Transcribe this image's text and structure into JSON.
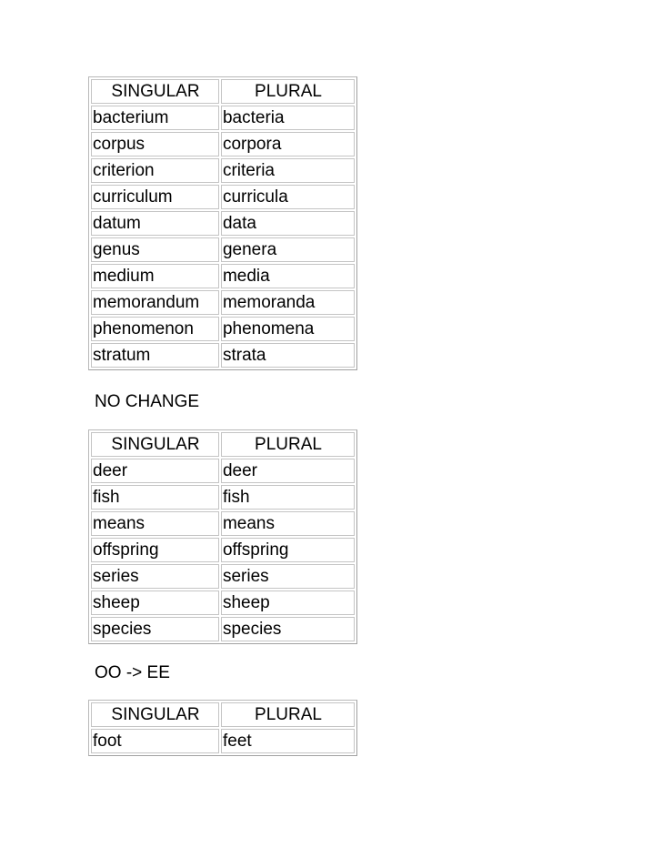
{
  "tables": [
    {
      "heading": null,
      "headers": [
        "SINGULAR",
        "PLURAL"
      ],
      "rows": [
        [
          "bacterium",
          "bacteria"
        ],
        [
          "corpus",
          "corpora"
        ],
        [
          "criterion",
          "criteria"
        ],
        [
          "curriculum",
          "curricula"
        ],
        [
          "datum",
          "data"
        ],
        [
          "genus",
          "genera"
        ],
        [
          "medium",
          "media"
        ],
        [
          "memorandum",
          "memoranda"
        ],
        [
          "phenomenon",
          "phenomena"
        ],
        [
          "stratum",
          "strata"
        ]
      ]
    },
    {
      "heading": "NO CHANGE",
      "headers": [
        "SINGULAR",
        "PLURAL"
      ],
      "rows": [
        [
          "deer",
          "deer"
        ],
        [
          "fish",
          "fish"
        ],
        [
          "means",
          "means"
        ],
        [
          "offspring",
          "offspring"
        ],
        [
          "series",
          "series"
        ],
        [
          "sheep",
          "sheep"
        ],
        [
          "species",
          "species"
        ]
      ]
    },
    {
      "heading": "OO -> EE",
      "headers": [
        "SINGULAR",
        "PLURAL"
      ],
      "rows": [
        [
          "foot",
          "feet"
        ]
      ]
    }
  ]
}
